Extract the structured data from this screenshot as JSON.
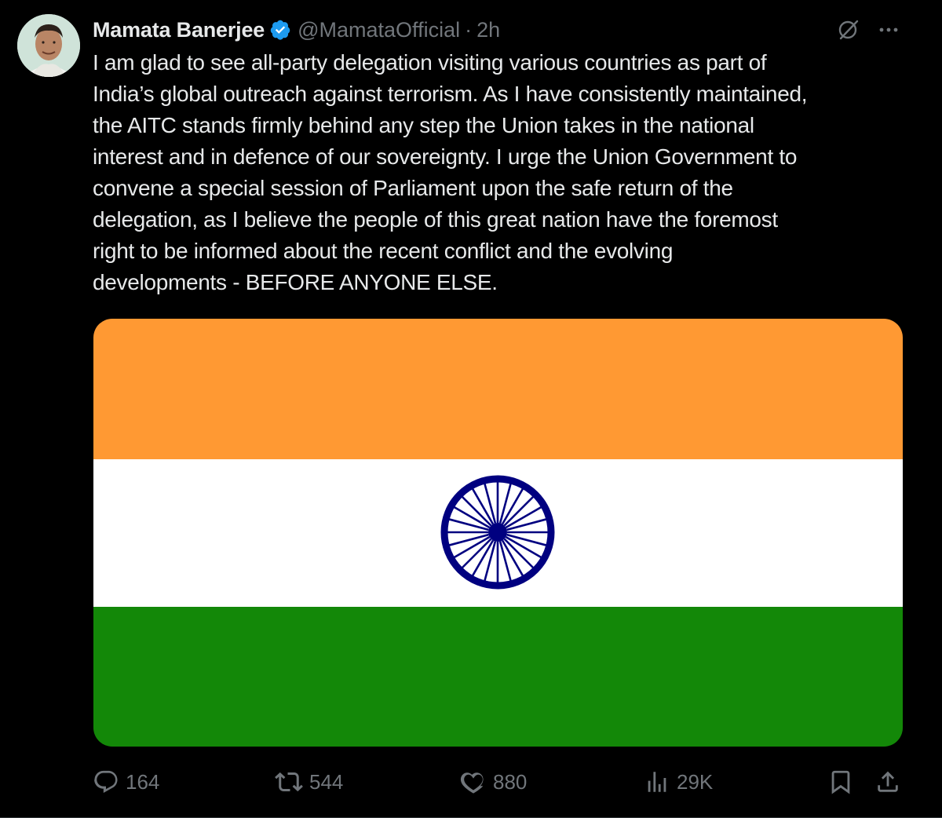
{
  "author": {
    "display_name": "Mamata Banerjee",
    "handle": "@MamataOfficial",
    "separator": "·",
    "time": "2h",
    "verified": true
  },
  "tweet": {
    "text": "I am glad to see all-party delegation visiting various countries as part of\nIndia’s global outreach against terrorism. As I have consistently maintained,\nthe AITC stands firmly behind any step the Union takes in the national\ninterest and in defence of our sovereignty. I urge the Union Government to\nconvene a special session of Parliament upon the safe return of the\ndelegation, as I believe the people of this great nation have the foremost\nright to be informed about the recent conflict and the evolving\ndevelopments - BEFORE ANYONE ELSE."
  },
  "media": {
    "type": "flag-image",
    "subject": "indian-national-flag",
    "colors": {
      "saffron": "#FF9933",
      "white": "#FFFFFF",
      "green": "#138808",
      "chakra": "#000080"
    }
  },
  "actions": {
    "replies": "164",
    "reposts": "544",
    "likes": "880",
    "views": "29K"
  },
  "icons": [
    "verified-badge-icon",
    "grok-icon",
    "more-icon",
    "reply-icon",
    "repost-icon",
    "like-icon",
    "views-icon",
    "bookmark-icon",
    "share-icon"
  ],
  "theme": {
    "background": "#000000",
    "text_primary": "#e7e9ea",
    "text_secondary": "#71767b",
    "verified_blue": "#1d9bf0"
  }
}
